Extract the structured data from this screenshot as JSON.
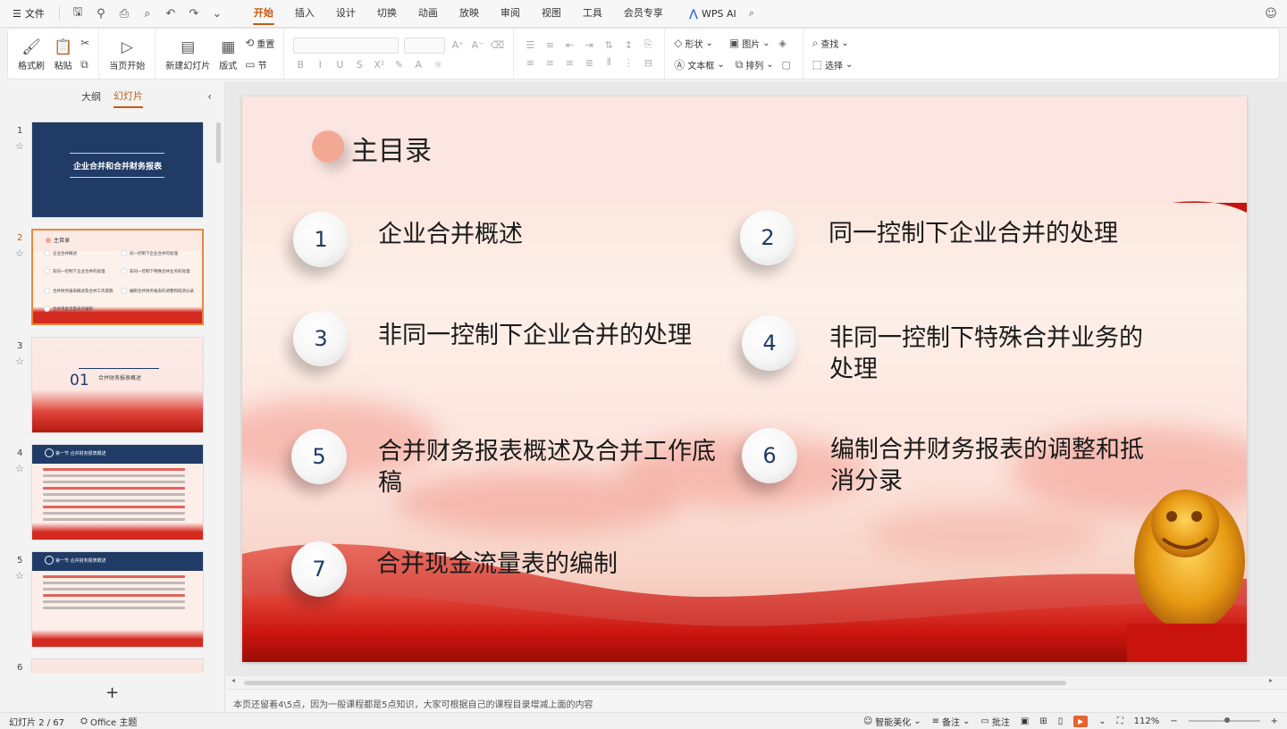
{
  "menubar": {
    "file_label": "文件",
    "tabs": [
      "开始",
      "插入",
      "设计",
      "切换",
      "动画",
      "放映",
      "审阅",
      "视图",
      "工具",
      "会员专享"
    ],
    "ai_label": "WPS AI"
  },
  "ribbon": {
    "format_painter": "格式刷",
    "paste": "粘贴",
    "from_current": "当页开始",
    "new_slide": "新建幻灯片",
    "layout": "版式",
    "reset": "重置",
    "section": "节",
    "shape": "形状",
    "picture": "图片",
    "textbox": "文本框",
    "arrange": "排列",
    "find": "查找",
    "select": "选择"
  },
  "left_panel": {
    "tab_outline": "大纲",
    "tab_slides": "幻灯片",
    "slides": [
      {
        "num": "1",
        "title": "企业合并和合并财务报表"
      },
      {
        "num": "2",
        "title": "主目录",
        "items": [
          "企业合并概述",
          "同一控制下企业合并的处理",
          "非同一控制下企业合并的处理",
          "非同一控制下特殊合并业务的处理",
          "合并财务报表概述及合并工作底稿",
          "编制合并财务报表的调整和抵消分录",
          "合并现金流量表的编制"
        ]
      },
      {
        "num": "3",
        "number": "01",
        "subtitle": "合并财务报表概述"
      },
      {
        "num": "4",
        "header": "第一节  合并财务报表概述"
      },
      {
        "num": "5",
        "header": "第一节  合并财务报表概述"
      },
      {
        "num": "6"
      }
    ]
  },
  "slide": {
    "title": "主目录",
    "items": [
      {
        "num": "1",
        "text": "企业合并概述"
      },
      {
        "num": "2",
        "text": "同一控制下企业合并的处理"
      },
      {
        "num": "3",
        "text": "非同一控制下企业合并的处理"
      },
      {
        "num": "4",
        "text": "非同一控制下特殊合并业务的处理"
      },
      {
        "num": "5",
        "text": "合并财务报表概述及合并工作底稿"
      },
      {
        "num": "6",
        "text": "编制合并财务报表的调整和抵消分录"
      },
      {
        "num": "7",
        "text": "合并现金流量表的编制"
      }
    ],
    "colors": {
      "accent": "#c55a11",
      "navy": "#1f3b66",
      "red": "#d42a1f",
      "dot": "#f3a894"
    }
  },
  "notes": "本页还留着4\\5点，因为一般课程都是5点知识，大家可根据自己的课程目录增减上面的内容",
  "statusbar": {
    "slide_count": "幻灯片 2 / 67",
    "theme": "Office 主题",
    "beautify": "智能美化",
    "notes": "备注",
    "comments": "批注",
    "zoom": "112%"
  }
}
